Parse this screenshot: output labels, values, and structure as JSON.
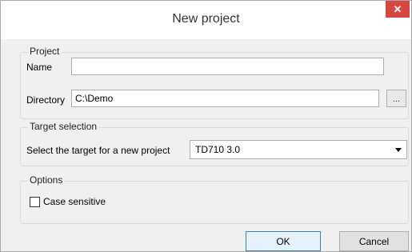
{
  "dialog": {
    "title": "New project",
    "close_glyph": "✕"
  },
  "project_group": {
    "legend": "Project",
    "name_label": "Name",
    "name_value": "",
    "directory_label": "Directory",
    "directory_value": "C:\\Demo",
    "browse_label": "..."
  },
  "target_group": {
    "legend": "Target selection",
    "select_label": "Select the target for a new project",
    "selected_target": "TD710 3.0"
  },
  "options_group": {
    "legend": "Options",
    "case_sensitive_label": "Case sensitive",
    "case_sensitive_checked": false
  },
  "buttons": {
    "ok_label": "OK",
    "cancel_label": "Cancel"
  },
  "colors": {
    "close_button": "#d74740",
    "default_button_border": "#3c7fb1"
  }
}
